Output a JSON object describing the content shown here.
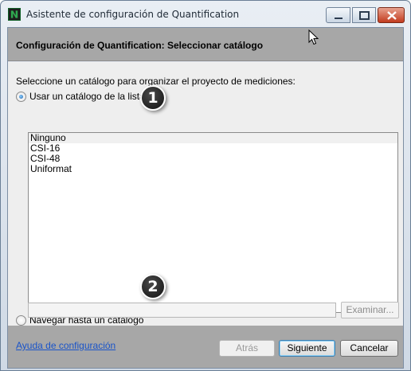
{
  "window": {
    "title": "Asistente de configuración de Quantification",
    "icon": "quantification-app-icon"
  },
  "header": {
    "title": "Configuración de Quantification: Seleccionar catálogo"
  },
  "main": {
    "prompt": "Seleccione un catálogo para organizar el proyecto de mediciones:",
    "option_list": {
      "label": "Usar un catálogo de la lista",
      "checked": true,
      "items": [
        "Ninguno",
        "CSI-16",
        "CSI-48",
        "Uniformat"
      ],
      "selected_item": "Ninguno"
    },
    "option_browse": {
      "label": "Navegar hasta un catálogo",
      "checked": false,
      "path_value": "",
      "browse_label": "Examinar..."
    }
  },
  "callouts": [
    "1",
    "2"
  ],
  "footer": {
    "help_link": "Ayuda de configuración",
    "back_label": "Atrás",
    "next_label": "Siguiente",
    "cancel_label": "Cancelar"
  },
  "colors": {
    "header_band": "#a7a7a7",
    "panel": "#eeeeee",
    "link": "#1a54c9",
    "close_button": "#c23b1e"
  }
}
